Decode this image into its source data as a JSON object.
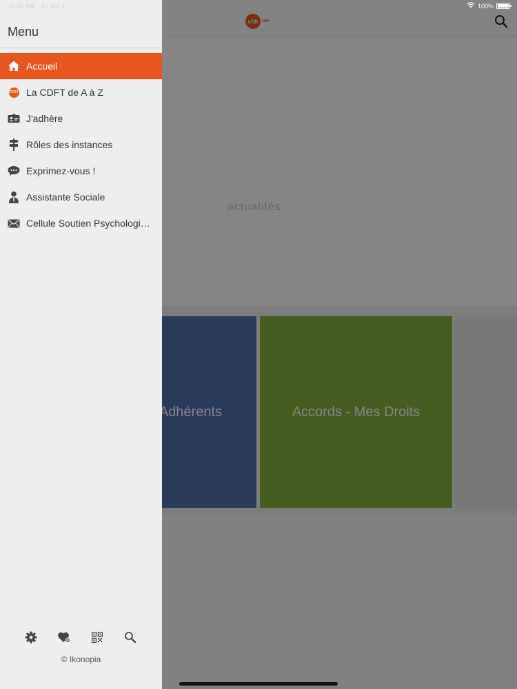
{
  "status_bar": {
    "time": "10:49 AM",
    "date": "Fri Apr 1",
    "battery": "100%"
  },
  "colors": {
    "accent": "#e9561b",
    "tile_blue": "#4f6fad",
    "tile_green": "#86b23e"
  },
  "main": {
    "logo_text": "cfdt",
    "logo_sub": "rdbi",
    "banner_text": "actualités",
    "tiles": [
      {
        "label": "Adhérents"
      },
      {
        "label": "Accords - Mes Droits"
      }
    ]
  },
  "drawer": {
    "title": "Menu",
    "items": [
      {
        "label": "Accueil",
        "icon": "home-icon",
        "active": true
      },
      {
        "label": "La CDFT de A à Z",
        "icon": "cfdt-logo-icon"
      },
      {
        "label": "J'adhère",
        "icon": "id-card-icon"
      },
      {
        "label": "Rôles des instances",
        "icon": "signpost-icon"
      },
      {
        "label": "Exprimez-vous !",
        "icon": "chat-bubble-icon"
      },
      {
        "label": "Assistante Sociale",
        "icon": "person-icon"
      },
      {
        "label": "Cellule Soutien Psychologique",
        "icon": "envelope-icon"
      }
    ],
    "tools": [
      "settings-icon",
      "favorites-icon",
      "qr-code-icon",
      "search-icon"
    ],
    "copyright": "© Ikonopia"
  }
}
